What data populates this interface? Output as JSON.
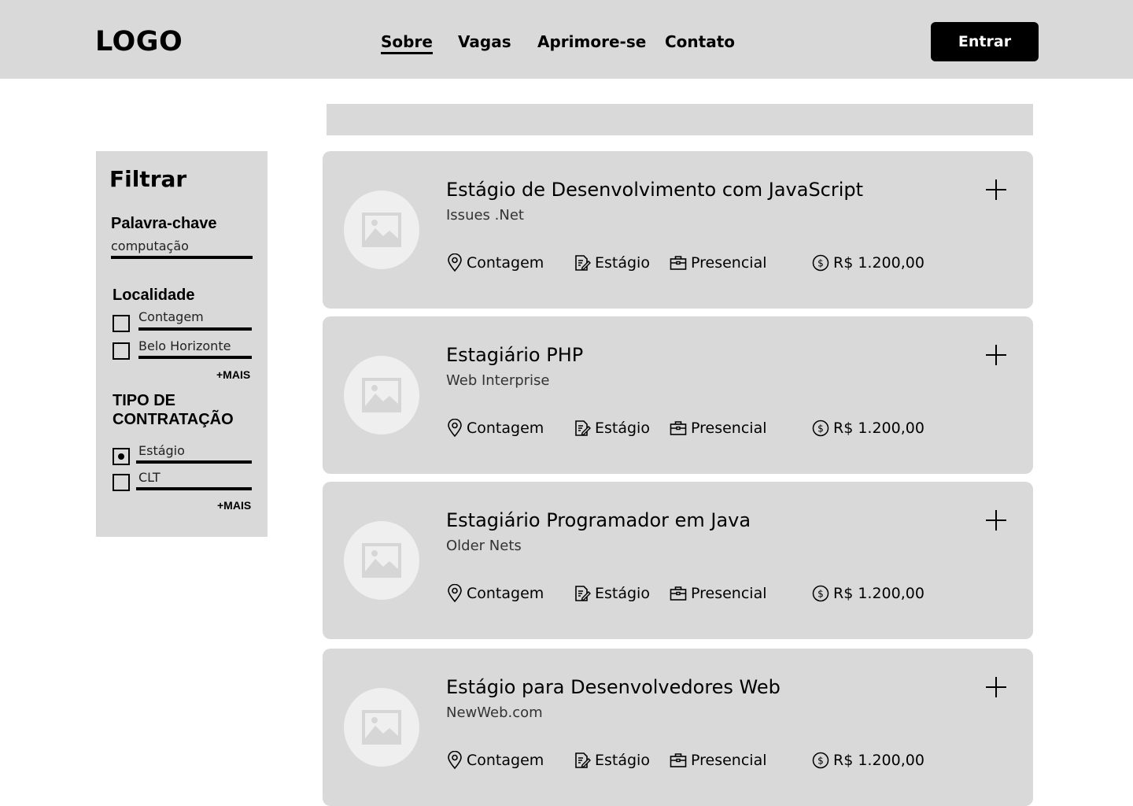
{
  "header": {
    "logo": "LOGO",
    "nav": [
      {
        "label": "Sobre",
        "active": true
      },
      {
        "label": "Vagas",
        "active": false
      },
      {
        "label": "Aprimore-se",
        "active": false
      },
      {
        "label": "Contato",
        "active": false
      }
    ],
    "login_label": "Entrar"
  },
  "search": {
    "value": ""
  },
  "filter": {
    "title": "Filtrar",
    "keyword": {
      "label": "Palavra-chave",
      "value": "computação"
    },
    "location": {
      "label": "Localidade",
      "options": [
        {
          "label": "Contagem",
          "checked": false
        },
        {
          "label": "Belo Horizonte",
          "checked": false
        }
      ],
      "more_label": "+MAIS"
    },
    "contract": {
      "label_line1": "TIPO DE",
      "label_line2": "CONTRATAÇÃO",
      "options": [
        {
          "label": "Estágio",
          "checked": true
        },
        {
          "label": "CLT",
          "checked": false
        }
      ],
      "more_label": "+MAIS"
    }
  },
  "jobs": [
    {
      "title": "Estágio de Desenvolvimento com JavaScript",
      "company": "Issues .Net",
      "city": "Contagem",
      "type": "Estágio",
      "mode": "Presencial",
      "salary": "R$ 1.200,00"
    },
    {
      "title": "Estagiário PHP",
      "company": "Web Interprise",
      "city": "Contagem",
      "type": "Estágio",
      "mode": "Presencial",
      "salary": "R$ 1.200,00"
    },
    {
      "title": "Estagiário Programador em Java",
      "company": "Older Nets",
      "city": "Contagem",
      "type": "Estágio",
      "mode": "Presencial",
      "salary": "R$ 1.200,00"
    },
    {
      "title": "Estágio para Desenvolvedores Web",
      "company": "NewWeb.com",
      "city": "Contagem",
      "type": "Estágio",
      "mode": "Presencial",
      "salary": "R$ 1.200,00"
    }
  ],
  "icons": {
    "location": "map-pin-icon",
    "contract": "document-edit-icon",
    "mode": "briefcase-icon",
    "salary": "dollar-coin-icon",
    "add": "plus-icon",
    "thumbnail": "image-placeholder-icon"
  }
}
